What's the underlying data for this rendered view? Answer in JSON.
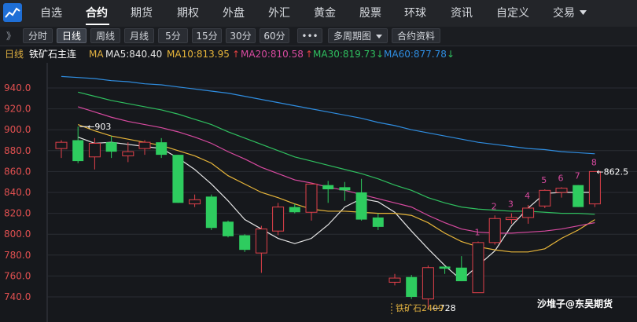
{
  "nav": {
    "items": [
      "自选",
      "合约",
      "期货",
      "期权",
      "外盘",
      "外汇",
      "黄金",
      "股票",
      "环球",
      "资讯",
      "自定义",
      "交易"
    ],
    "active_index": 1
  },
  "toolbar": {
    "expand_glyph": "》",
    "buttons": [
      "分时",
      "日线",
      "周线",
      "月线",
      "5分",
      "15分",
      "30分",
      "60分"
    ],
    "active_index": 1,
    "more_label": "•••",
    "multi_period_label": "多周期图",
    "contract_info_label": "合约资料"
  },
  "info": {
    "period": "日线",
    "contract": "铁矿石主连",
    "ma_label": "MA",
    "ma5": "MA5:840.40",
    "ma10": "MA10:813.95",
    "ma20": "MA20:810.58",
    "ma30": "MA30:819.73",
    "ma60": "MA60:877.78",
    "arrow_up": "↑",
    "arrow_down": "↓"
  },
  "colors": {
    "up": "#e0404a",
    "down": "#2ecc5f",
    "ma5": "#e6e6e6",
    "ma10": "#e8b63a",
    "ma20": "#d84aa0",
    "ma30": "#2fbf5f",
    "ma60": "#2f8de0",
    "grid": "#2a2d33",
    "axis_text": "#e05050"
  },
  "chart_data": {
    "type": "candlestick",
    "ylim": [
      728,
      975
    ],
    "y_ticks": [
      940,
      920,
      900,
      880,
      860,
      840,
      820,
      800,
      780,
      760,
      740
    ],
    "candles": [
      {
        "o": 882,
        "h": 890,
        "l": 873,
        "c": 888
      },
      {
        "o": 890,
        "h": 903,
        "l": 868,
        "c": 870
      },
      {
        "o": 874,
        "h": 892,
        "l": 862,
        "c": 887
      },
      {
        "o": 888,
        "h": 894,
        "l": 873,
        "c": 879
      },
      {
        "o": 875,
        "h": 888,
        "l": 869,
        "c": 879
      },
      {
        "o": 882,
        "h": 890,
        "l": 876,
        "c": 888
      },
      {
        "o": 888,
        "h": 892,
        "l": 873,
        "c": 876
      },
      {
        "o": 876,
        "h": 876,
        "l": 830,
        "c": 830
      },
      {
        "o": 829,
        "h": 838,
        "l": 826,
        "c": 833
      },
      {
        "o": 836,
        "h": 838,
        "l": 804,
        "c": 806
      },
      {
        "o": 812,
        "h": 813,
        "l": 797,
        "c": 798
      },
      {
        "o": 799,
        "h": 800,
        "l": 783,
        "c": 785
      },
      {
        "o": 782,
        "h": 808,
        "l": 763,
        "c": 805
      },
      {
        "o": 803,
        "h": 830,
        "l": 799,
        "c": 826
      },
      {
        "o": 826,
        "h": 829,
        "l": 820,
        "c": 821
      },
      {
        "o": 821,
        "h": 849,
        "l": 813,
        "c": 848
      },
      {
        "o": 847,
        "h": 851,
        "l": 830,
        "c": 843
      },
      {
        "o": 845,
        "h": 850,
        "l": 832,
        "c": 842
      },
      {
        "o": 840,
        "h": 853,
        "l": 813,
        "c": 814
      },
      {
        "o": 816,
        "h": 820,
        "l": 804,
        "c": 807
      },
      {
        "o": 754,
        "h": 762,
        "l": 751,
        "c": 758
      },
      {
        "o": 759,
        "h": 761,
        "l": 738,
        "c": 740
      },
      {
        "o": 738,
        "h": 770,
        "l": 728,
        "c": 768
      },
      {
        "o": 769,
        "h": 769,
        "l": 762,
        "c": 767
      },
      {
        "o": 768,
        "h": 779,
        "l": 755,
        "c": 755
      },
      {
        "o": 744,
        "h": 793,
        "l": 744,
        "c": 792
      },
      {
        "o": 792,
        "h": 818,
        "l": 790,
        "c": 815
      },
      {
        "o": 814,
        "h": 820,
        "l": 810,
        "c": 816
      },
      {
        "o": 816,
        "h": 828,
        "l": 810,
        "c": 825
      },
      {
        "o": 827,
        "h": 843,
        "l": 825,
        "c": 842
      },
      {
        "o": 840,
        "h": 845,
        "l": 835,
        "c": 844
      },
      {
        "o": 847,
        "h": 847,
        "l": 826,
        "c": 826
      },
      {
        "o": 829,
        "h": 860,
        "l": 826,
        "c": 860
      }
    ],
    "ma_series": [
      {
        "name": "MA5",
        "values": [
          null,
          893,
          887,
          888,
          886,
          884,
          882,
          873,
          862,
          848,
          832,
          814,
          805,
          796,
          791,
          796,
          809,
          826,
          834,
          831,
          821,
          803,
          786,
          770,
          756,
          770,
          784,
          808,
          825,
          839,
          840,
          840,
          840
        ]
      },
      {
        "name": "MA10",
        "values": [
          null,
          905,
          899,
          894,
          891,
          888,
          885,
          880,
          875,
          868,
          856,
          848,
          840,
          835,
          829,
          824,
          822,
          822,
          821,
          820,
          820,
          818,
          811,
          801,
          793,
          788,
          785,
          783,
          783,
          786,
          796,
          804,
          814
        ]
      },
      {
        "name": "MA20",
        "values": [
          null,
          922,
          917,
          912,
          908,
          905,
          902,
          898,
          893,
          887,
          879,
          872,
          864,
          858,
          852,
          849,
          845,
          842,
          838,
          834,
          830,
          826,
          818,
          811,
          805,
          802,
          801,
          801,
          802,
          803,
          805,
          808,
          811
        ]
      },
      {
        "name": "MA30",
        "values": [
          null,
          936,
          932,
          928,
          925,
          922,
          919,
          915,
          910,
          905,
          898,
          892,
          886,
          880,
          874,
          870,
          866,
          862,
          858,
          853,
          847,
          842,
          835,
          830,
          826,
          824,
          823,
          822,
          822,
          821,
          820,
          820,
          819
        ]
      },
      {
        "name": "MA60",
        "values": [
          951,
          950,
          949,
          947,
          946,
          944,
          943,
          941,
          939,
          937,
          935,
          932,
          929,
          926,
          923,
          920,
          917,
          914,
          911,
          907,
          904,
          900,
          897,
          894,
          891,
          888,
          886,
          884,
          882,
          881,
          879,
          878,
          877
        ]
      }
    ],
    "annotations": {
      "high_label": "903",
      "low_label": "728",
      "last_label": "862.5",
      "count_labels": [
        "1",
        "2",
        "3",
        "4",
        "5",
        "6",
        "7",
        "8"
      ],
      "contract_marker": "铁矿石2409"
    }
  },
  "watermark": "沙堆子@东吴期货"
}
